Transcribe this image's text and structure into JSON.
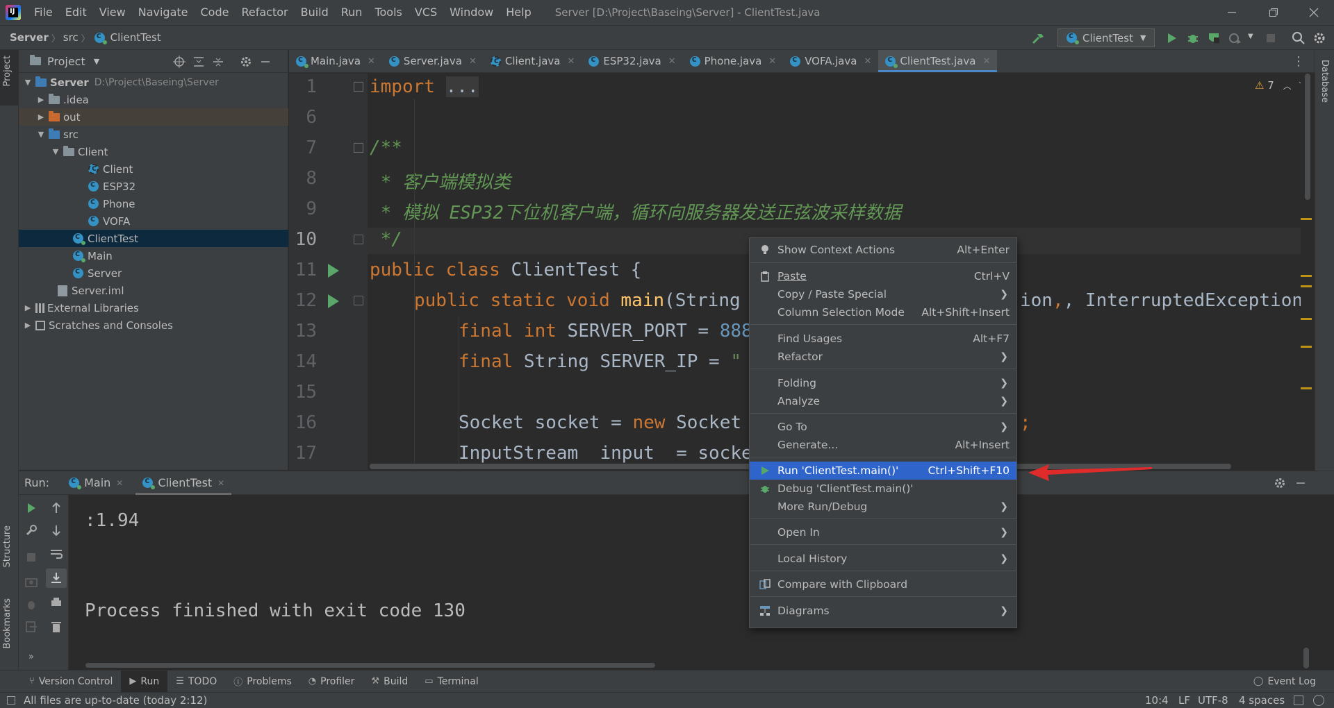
{
  "titlebar": {
    "menu": [
      "File",
      "Edit",
      "View",
      "Navigate",
      "Code",
      "Refactor",
      "Build",
      "Run",
      "Tools",
      "VCS",
      "Window",
      "Help"
    ],
    "window_title": "Server [D:\\Project\\Baseing\\Server] - ClientTest.java"
  },
  "navbar": {
    "breadcrumb": [
      "Server",
      "src",
      "ClientTest"
    ],
    "run_config": "ClientTest"
  },
  "left_strip": {
    "project_tab": "Project",
    "structure_tab": "Structure",
    "bookmarks_tab": "Bookmarks"
  },
  "right_strip": {
    "database_tab": "Database"
  },
  "project": {
    "header": "Project",
    "tree": [
      {
        "label": "Server",
        "path": "D:\\Project\\Baseing\\Server"
      },
      {
        "label": ".idea"
      },
      {
        "label": "out"
      },
      {
        "label": "src"
      },
      {
        "label": "Client"
      },
      {
        "label": "Client"
      },
      {
        "label": "ESP32"
      },
      {
        "label": "Phone"
      },
      {
        "label": "VOFA"
      },
      {
        "label": "ClientTest"
      },
      {
        "label": "Main"
      },
      {
        "label": "Server"
      },
      {
        "label": "Server.iml"
      },
      {
        "label": "External Libraries"
      },
      {
        "label": "Scratches and Consoles"
      }
    ]
  },
  "editor": {
    "tabs": [
      "Main.java",
      "Server.java",
      "Client.java",
      "ESP32.java",
      "Phone.java",
      "VOFA.java",
      "ClientTest.java"
    ],
    "warnings": "7",
    "line_numbers": [
      "1",
      "6",
      "7",
      "8",
      "9",
      "10",
      "11",
      "12",
      "13",
      "14",
      "15",
      "16",
      "17"
    ],
    "lines": {
      "l1_kw": "import",
      "l1_fold": "...",
      "l7": "/**",
      "l8": " * 客户端模拟类",
      "l9": " * 模拟 ESP32下位机客户端，循环向服务器发送正弦波采样数据",
      "l10": " */",
      "l11_kw": "public class",
      "l11_rest": " ClientTest {",
      "l12_kw": "public static void",
      "l12_fn": "main",
      "l12_a": "(String",
      "l12_b": "ion",
      "l12_c": ", InterruptedException {",
      "l13_kw": "final int",
      "l13_rest": " SERVER_PORT = ",
      "l13_num": "888",
      "l14_kw": "final",
      "l14_rest": " String SERVER_IP = ",
      "l14_str": "\"",
      "l16_a": "Socket socket = ",
      "l16_kw": "new",
      "l16_b": " Socket",
      "l16_c": ";",
      "l17": "InputStream  input  = socke"
    }
  },
  "run": {
    "label": "Run:",
    "tabs": [
      "Main",
      "ClientTest"
    ],
    "output": [
      ":1.94",
      "Process finished with exit code 130"
    ]
  },
  "context_menu": {
    "items": [
      {
        "label": "Show Context Actions",
        "shortcut": "Alt+Enter"
      },
      {
        "label": "Paste",
        "shortcut": "Ctrl+V"
      },
      {
        "label": "Copy / Paste Special"
      },
      {
        "label": "Column Selection Mode",
        "shortcut": "Alt+Shift+Insert"
      },
      {
        "label": "Find Usages",
        "shortcut": "Alt+F7"
      },
      {
        "label": "Refactor"
      },
      {
        "label": "Folding"
      },
      {
        "label": "Analyze"
      },
      {
        "label": "Go To"
      },
      {
        "label": "Generate...",
        "shortcut": "Alt+Insert"
      },
      {
        "label": "Run 'ClientTest.main()'",
        "shortcut": "Ctrl+Shift+F10"
      },
      {
        "label": "Debug 'ClientTest.main()'"
      },
      {
        "label": "More Run/Debug"
      },
      {
        "label": "Open In"
      },
      {
        "label": "Local History"
      },
      {
        "label": "Compare with Clipboard"
      },
      {
        "label": "Diagrams"
      }
    ]
  },
  "bottom_bar": {
    "tabs": [
      "Version Control",
      "Run",
      "TODO",
      "Problems",
      "Profiler",
      "Build",
      "Terminal"
    ],
    "event_log": "Event Log"
  },
  "status": {
    "message": "All files are up-to-date (today 2:12)",
    "position": "10:4",
    "line_sep": "LF",
    "encoding": "UTF-8",
    "indent": "4 spaces"
  },
  "colors": {
    "accent": "#2f65ca",
    "run_green": "#59a869",
    "arrow_red": "#e02b2b"
  }
}
